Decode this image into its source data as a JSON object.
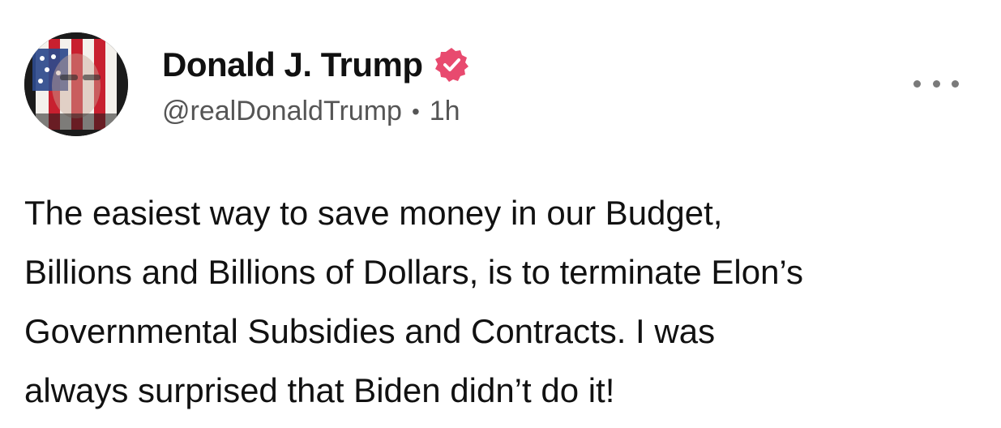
{
  "post": {
    "author": {
      "display_name": "Donald J. Trump",
      "handle": "@realDonaldTrump",
      "verified": true,
      "avatar_icon": "flag-portrait-avatar"
    },
    "meta": {
      "separator": "•",
      "timestamp": "1h"
    },
    "more_icon": "more-horizontal-icon",
    "text": "The easiest way to save money in our Budget,\nBillions and Billions of Dollars, is to terminate Elon’s\nGovernmental Subsidies and Contracts. I was\nalways surprised that Biden didn’t do it!"
  },
  "colors": {
    "verified_badge": "#e84a6f",
    "text_primary": "#111111",
    "text_secondary": "#555555",
    "flag_red": "#c8202f",
    "flag_blue": "#2c4a8c"
  }
}
